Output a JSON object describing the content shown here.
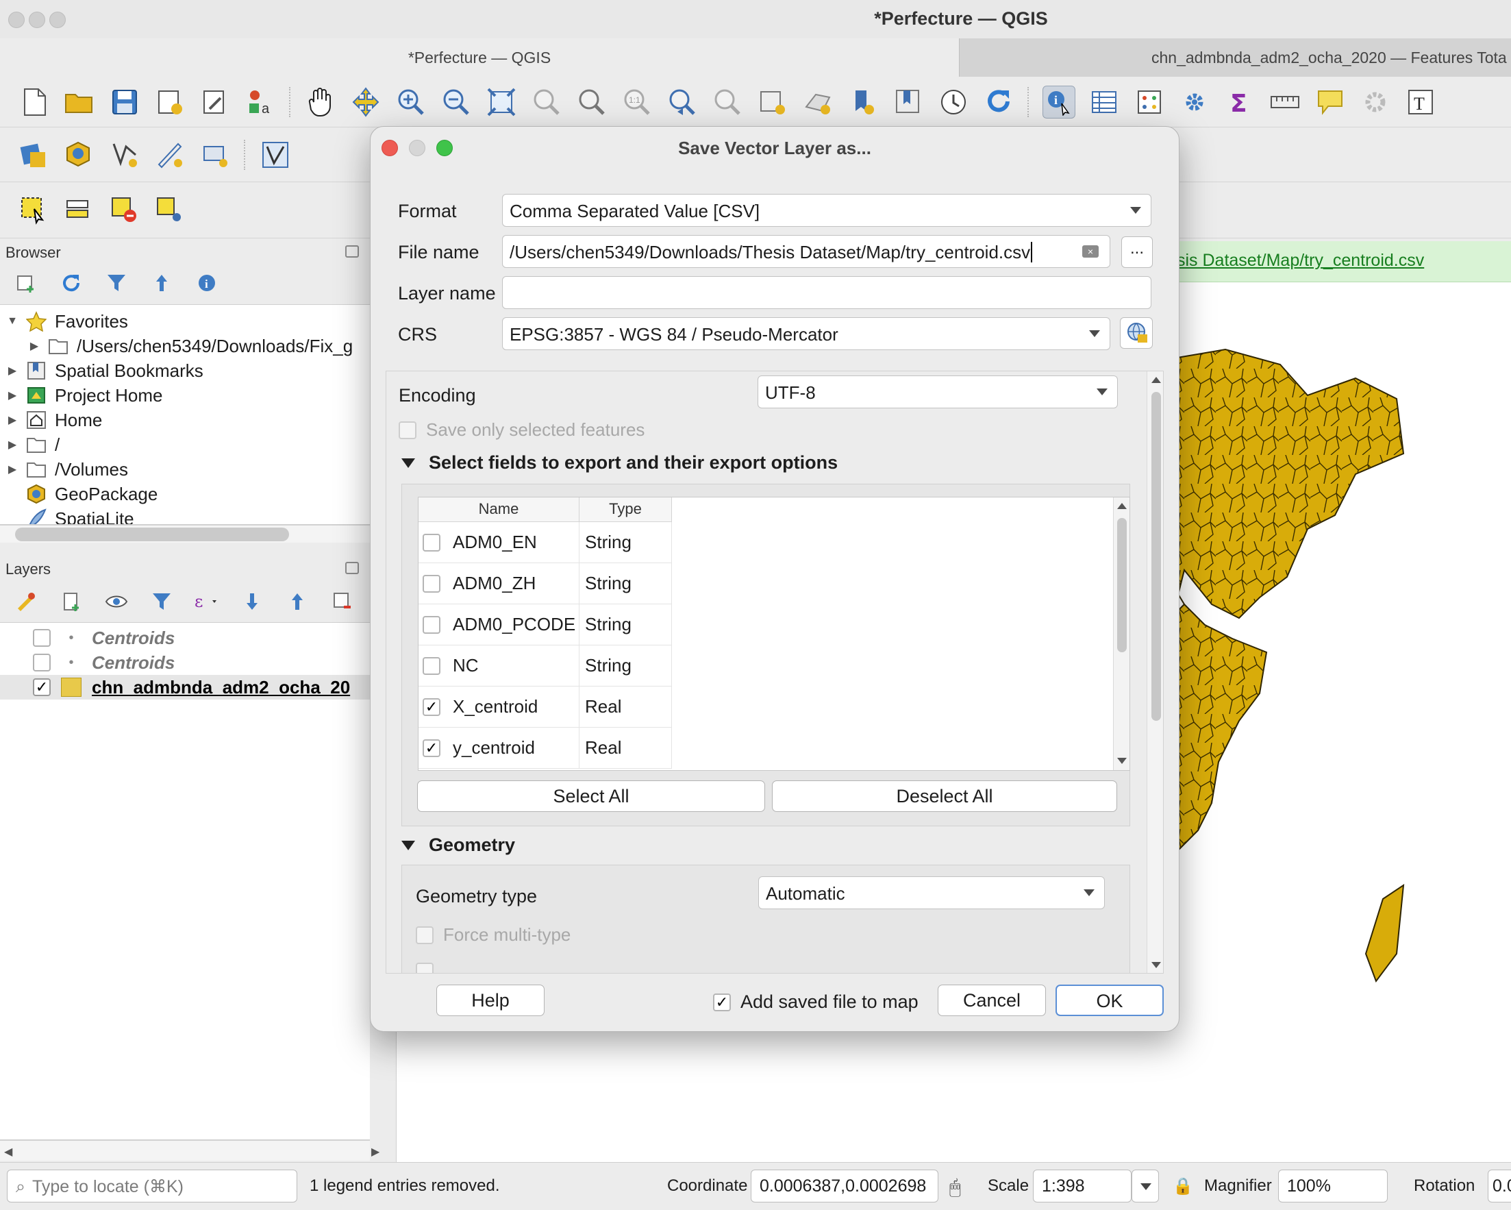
{
  "window": {
    "title": "*Perfecture — QGIS",
    "tabs": [
      "*Perfecture — QGIS",
      "chn_admbnda_adm2_ocha_2020 — Features Tota"
    ]
  },
  "toolbar": {
    "row1_icons": [
      "new-project-icon",
      "open-project-icon",
      "save-project-icon",
      "print-layout-icon",
      "style-manager-icon",
      "labels-icon",
      "pan-icon",
      "pan-to-selection-icon",
      "zoom-in-icon",
      "zoom-out-icon",
      "zoom-full-icon",
      "zoom-to-selection-icon",
      "zoom-to-layer-icon",
      "zoom-native-icon",
      "zoom-last-icon",
      "zoom-next-icon",
      "new-map-view-icon",
      "new-3d-view-icon",
      "new-bookmark-icon",
      "show-bookmarks-icon",
      "temporal-controller-icon",
      "refresh-icon",
      "identify-features-icon",
      "attribute-table-icon",
      "field-calculator-icon",
      "processing-toolbox-icon",
      "statistics-icon",
      "measure-icon",
      "map-tips-icon",
      "settings-icon",
      "text-annotation-icon"
    ],
    "row2_icons": [
      "data-source-manager-icon",
      "new-geopackage-layer-icon",
      "new-shapefile-layer-icon",
      "digitize-icon",
      "new-virtual-layer-icon",
      "edit-vertices-icon",
      "label-tools-icon",
      "python-console-icon",
      "plugins-icon"
    ],
    "row3_icons": [
      "select-features-icon",
      "select-attributes-icon",
      "deselect-all-icon",
      "select-location-icon"
    ]
  },
  "browser": {
    "title": "Browser",
    "items": [
      {
        "label": "Favorites",
        "icon": "star-icon",
        "expanded": true
      },
      {
        "label": "/Users/chen5349/Downloads/Fix_g",
        "icon": "folder-icon",
        "indent": true
      },
      {
        "label": "Spatial Bookmarks",
        "icon": "bookmark-icon"
      },
      {
        "label": "Project Home",
        "icon": "project-home-icon"
      },
      {
        "label": "Home",
        "icon": "home-icon"
      },
      {
        "label": "/",
        "icon": "folder-icon"
      },
      {
        "label": "/Volumes",
        "icon": "folder-icon"
      },
      {
        "label": "GeoPackage",
        "icon": "geopackage-icon"
      },
      {
        "label": "SpatiaLite",
        "icon": "spatialite-icon"
      }
    ]
  },
  "layers": {
    "title": "Layers",
    "items": [
      {
        "label": "Centroids",
        "checked": false,
        "style": "italic"
      },
      {
        "label": "Centroids",
        "checked": false,
        "style": "italic"
      },
      {
        "label": "chn_admbnda_adm2_ocha_20",
        "checked": true,
        "style": "bold"
      }
    ]
  },
  "message_bar": {
    "text": "sis Dataset/Map/try_centroid.csv"
  },
  "dialog": {
    "title": "Save Vector Layer as...",
    "format_label": "Format",
    "format_value": "Comma Separated Value [CSV]",
    "filename_label": "File name",
    "filename_value": "/Users/chen5349/Downloads/Thesis Dataset/Map/try_centroid.csv",
    "browse_label": "...",
    "layername_label": "Layer name",
    "layername_value": "",
    "crs_label": "CRS",
    "crs_value": "EPSG:3857 - WGS 84 / Pseudo-Mercator",
    "encoding_label": "Encoding",
    "encoding_value": "UTF-8",
    "save_selected_label": "Save only selected features",
    "fields_section_title": "Select fields to export and their export options",
    "field_columns": [
      "Name",
      "Type"
    ],
    "fields": [
      {
        "name": "ADM0_EN",
        "type": "String",
        "checked": false
      },
      {
        "name": "ADM0_ZH",
        "type": "String",
        "checked": false
      },
      {
        "name": "ADM0_PCODE",
        "type": "String",
        "checked": false
      },
      {
        "name": "NC",
        "type": "String",
        "checked": false
      },
      {
        "name": "X_centroid",
        "type": "Real",
        "checked": true
      },
      {
        "name": "y_centroid",
        "type": "Real",
        "checked": true
      }
    ],
    "select_all_label": "Select All",
    "deselect_all_label": "Deselect All",
    "geometry_section_title": "Geometry",
    "geometry_type_label": "Geometry type",
    "geometry_type_value": "Automatic",
    "force_multi_label": "Force multi-type",
    "help_label": "Help",
    "add_to_map_label": "Add saved file to map",
    "add_to_map_checked": true,
    "cancel_label": "Cancel",
    "ok_label": "OK"
  },
  "statusbar": {
    "locate_placeholder": "Type to locate (⌘K)",
    "message": "1 legend entries removed.",
    "coordinate_label": "Coordinate",
    "coordinate_value": "0.0006387,0.0002698",
    "scale_label": "Scale",
    "scale_value": "1:398",
    "magnifier_label": "Magnifier",
    "magnifier_value": "100%",
    "rotation_label": "Rotation",
    "rotation_value": "0.0"
  },
  "colors": {
    "map_fill": "#d8ac0a",
    "accent": "#5b8fd6",
    "message_green": "#177e1f"
  }
}
